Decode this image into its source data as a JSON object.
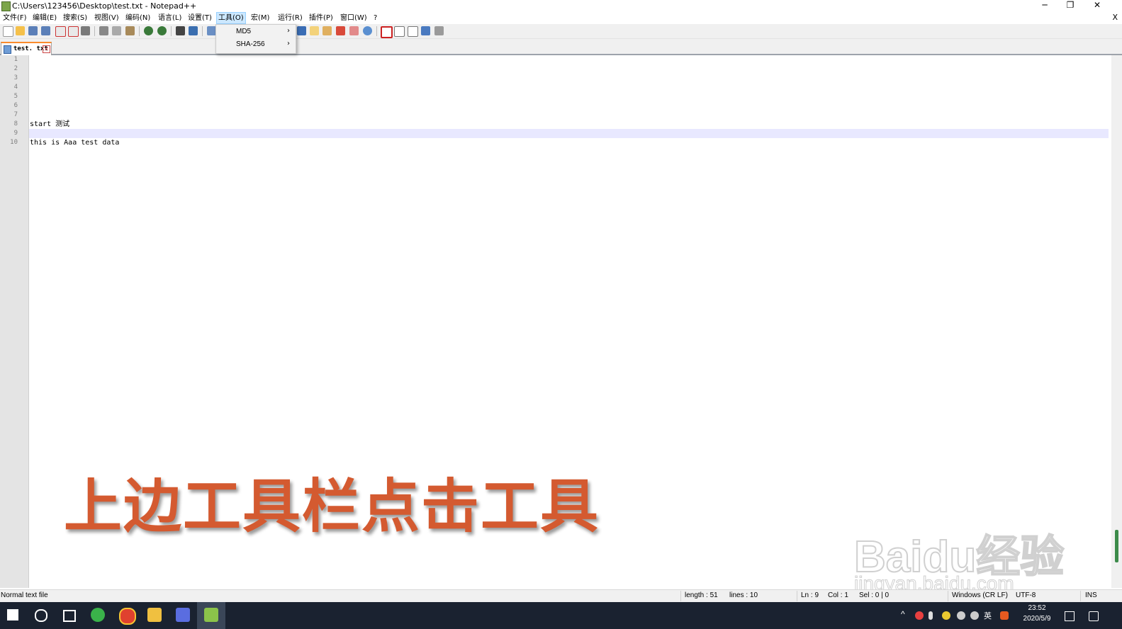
{
  "window": {
    "title": "C:\\Users\\123456\\Desktop\\test.txt - Notepad++",
    "minimize": "─",
    "restore": "❐",
    "close": "✕"
  },
  "menubar": {
    "items": [
      "文件(F)",
      "编辑(E)",
      "搜索(S)",
      "视图(V)",
      "编码(N)",
      "语言(L)",
      "设置(T)",
      "工具(O)",
      "宏(M)",
      "运行(R)",
      "插件(P)",
      "窗口(W)",
      "?"
    ],
    "active_index": 7,
    "doc_close": "X"
  },
  "tools_menu": {
    "items": [
      {
        "label": "MD5",
        "arrow": "›"
      },
      {
        "label": "SHA-256",
        "arrow": "›"
      }
    ]
  },
  "tab": {
    "label": "test. txt",
    "close_glyph": "✕"
  },
  "editor": {
    "line_numbers": [
      "1",
      "2",
      "3",
      "4",
      "5",
      "6",
      "7",
      "8",
      "9",
      "10"
    ],
    "lines": [
      "",
      "",
      "",
      "",
      "",
      "",
      "",
      "start 测试",
      "",
      "this is Aaa test data"
    ],
    "current_line": 9
  },
  "overlay": {
    "caption": "上边工具栏点击工具"
  },
  "watermark": {
    "logo": "Baidu经验",
    "url": "jingyan.baidu.com"
  },
  "statusbar": {
    "file_type": "Normal text file",
    "length": "length : 51",
    "lines": "lines : 10",
    "ln": "Ln : 9",
    "col": "Col : 1",
    "sel": "Sel : 0 | 0",
    "eol": "Windows (CR LF)",
    "encoding": "UTF-8",
    "mode": "INS"
  },
  "taskbar": {
    "clock_time": "23:52",
    "clock_date": "2020/5/9",
    "ime": "英",
    "apps": [
      "start-icon",
      "search-icon",
      "task-view-icon",
      "browser-360-icon",
      "chrome-icon",
      "file-explorer-icon",
      "app-icon",
      "notepadpp-icon"
    ]
  },
  "colors": {
    "accent_tab": "#fa8b2d",
    "current_line": "#e8e8ff",
    "caption": "#d45a30",
    "taskbar": "#1a2230"
  }
}
